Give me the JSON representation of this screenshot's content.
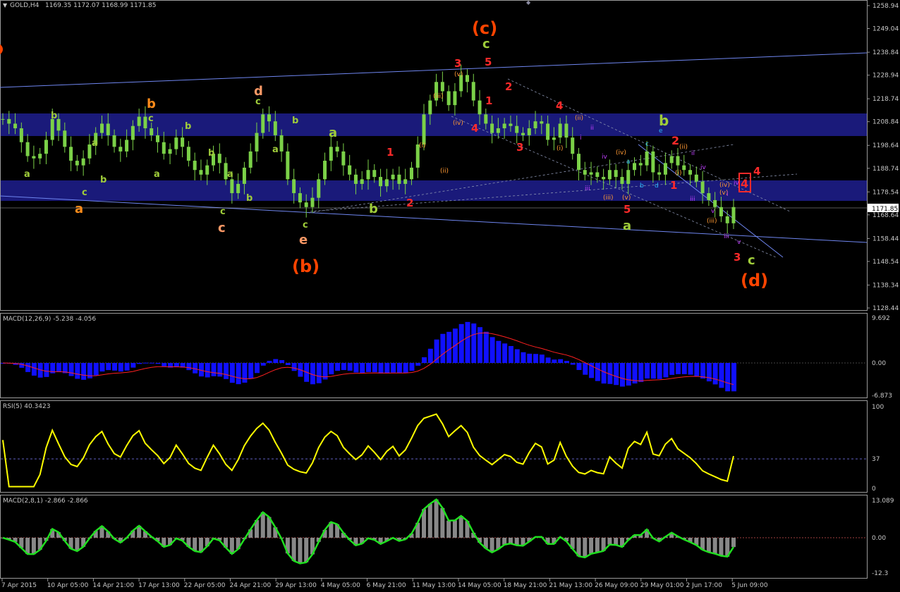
{
  "header": {
    "symbol": "GOLD,H4",
    "ohlc": "1169.35 1172.07 1168.99 1171.85",
    "current_price": "1171.85"
  },
  "colors": {
    "background": "#000000",
    "candle": "#7bd148",
    "band": "#1a1a7a",
    "trend_line": "#6f86f0",
    "dashed_line": "#8a93b0",
    "macd_hist": "#1010ff",
    "macd_signal": "#ff2020",
    "rsi_line": "#ffff00",
    "macd2_line": "#20e020",
    "macd2_hist": "#888888",
    "wave_red": "#ff2a2a",
    "wave_orange": "#ff7f00",
    "wave_green": "#9fcc3a",
    "wave_purple": "#c040ff",
    "wave_cyan": "#29b6f6"
  },
  "x_labels": [
    "7 Apr 2015",
    "10 Apr 05:00",
    "14 Apr 21:00",
    "17 Apr 13:00",
    "22 Apr 05:00",
    "24 Apr 21:00",
    "29 Apr 13:00",
    "4 May 05:00",
    "6 May 21:00",
    "11 May 13:00",
    "14 May 05:00",
    "18 May 21:00",
    "21 May 13:00",
    "26 May 09:00",
    "29 May 01:00",
    "2 Jun 17:00",
    "5 Jun 09:00"
  ],
  "price_labels": [
    "1258.94",
    "1249.04",
    "1238.84",
    "1228.94",
    "1218.74",
    "1208.84",
    "1198.64",
    "1188.74",
    "1178.54",
    "1168.64",
    "1158.44",
    "1148.54",
    "1138.34",
    "1128.44"
  ],
  "macd": {
    "title": "MACD(12,26,9) -5.238 -4.056",
    "labels": [
      "9.692",
      "0.00",
      "-6.873"
    ]
  },
  "rsi": {
    "title": "RSI(5) 40.3423",
    "labels": [
      "100",
      "37",
      "0"
    ]
  },
  "macd2": {
    "title": "MACD(2,8,1) -2.866 -2.866",
    "labels": [
      "13.089",
      "0.00",
      "-12.3"
    ]
  },
  "wave_labels": {
    "big": [
      {
        "t": "(c)",
        "c": "#ff4400"
      },
      {
        "t": "(b)",
        "c": "#ff4400"
      },
      {
        "t": "(d)",
        "c": "#ff4400"
      }
    ],
    "orange": [
      "b",
      "a",
      "d",
      "c",
      "e",
      "c",
      "b",
      "4"
    ],
    "green": [
      "a",
      "b",
      "c",
      "c",
      "b",
      "a",
      "b",
      "c",
      "a",
      "b",
      "a",
      "c",
      "b",
      "c",
      "a",
      "b",
      "b",
      "c",
      "c",
      "a"
    ],
    "red": [
      "3",
      "5",
      "1",
      "2",
      "4",
      "4",
      "3",
      "1",
      "2",
      "5",
      "1",
      "2",
      "3",
      "4"
    ],
    "minor": [
      "(v)",
      "(iii)",
      "(iv)",
      "(ii)",
      "(i)",
      "(ii)",
      "(i)",
      "(iv)",
      "(iii)",
      "(v)",
      "(ii)",
      "(i)",
      "(iv)",
      "(iii)",
      "(v)",
      "ii",
      "iv",
      "iii",
      "i",
      "iii",
      "iv",
      "v",
      "iii",
      "i",
      "ii",
      "iii",
      "iv",
      "v",
      "a",
      "b",
      "c",
      "d",
      "e",
      "c",
      "a"
    ]
  },
  "chart_data": {
    "type": "candlestick",
    "title": "GOLD,H4",
    "ylim": [
      1128.44,
      1262
    ],
    "x": "H4 bars, 7 Apr 2015 – 5 Jun 2015",
    "series": [
      {
        "name": "GOLD,H4",
        "values": [
          1210,
          1208,
          1206,
          1200,
          1194,
          1193,
          1195,
          1201,
          1210,
          1205,
          1198,
          1192,
          1190,
          1193,
          1199,
          1204,
          1208,
          1203,
          1198,
          1196,
          1201,
          1207,
          1211,
          1206,
          1203,
          1200,
          1195,
          1197,
          1202,
          1198,
          1192,
          1188,
          1186,
          1190,
          1195,
          1191,
          1184,
          1178,
          1182,
          1189,
          1196,
          1204,
          1212,
          1209,
          1203,
          1196,
          1184,
          1178,
          1174,
          1172,
          1176,
          1184,
          1192,
          1198,
          1196,
          1190,
          1186,
          1182,
          1184,
          1188,
          1185,
          1181,
          1184,
          1186,
          1182,
          1184,
          1189,
          1199,
          1212,
          1218,
          1226,
          1222,
          1216,
          1222,
          1229,
          1226,
          1218,
          1212,
          1208,
          1204,
          1206,
          1208,
          1207,
          1204,
          1203,
          1206,
          1209,
          1208,
          1201,
          1202,
          1208,
          1202,
          1195,
          1188,
          1186,
          1187,
          1185,
          1184,
          1188,
          1185,
          1182,
          1188,
          1191,
          1190,
          1196,
          1187,
          1186,
          1191,
          1194,
          1190,
          1188,
          1186,
          1183,
          1178,
          1175,
          1172,
          1168,
          1165,
          1172
        ]
      },
      {
        "name": "MACD(12,26,9)",
        "values": [
          -5.238
        ]
      },
      {
        "name": "RSI(5)",
        "values": [
          40.3423
        ]
      },
      {
        "name": "MACD(2,8,1)",
        "values": [
          -2.866
        ]
      }
    ]
  }
}
